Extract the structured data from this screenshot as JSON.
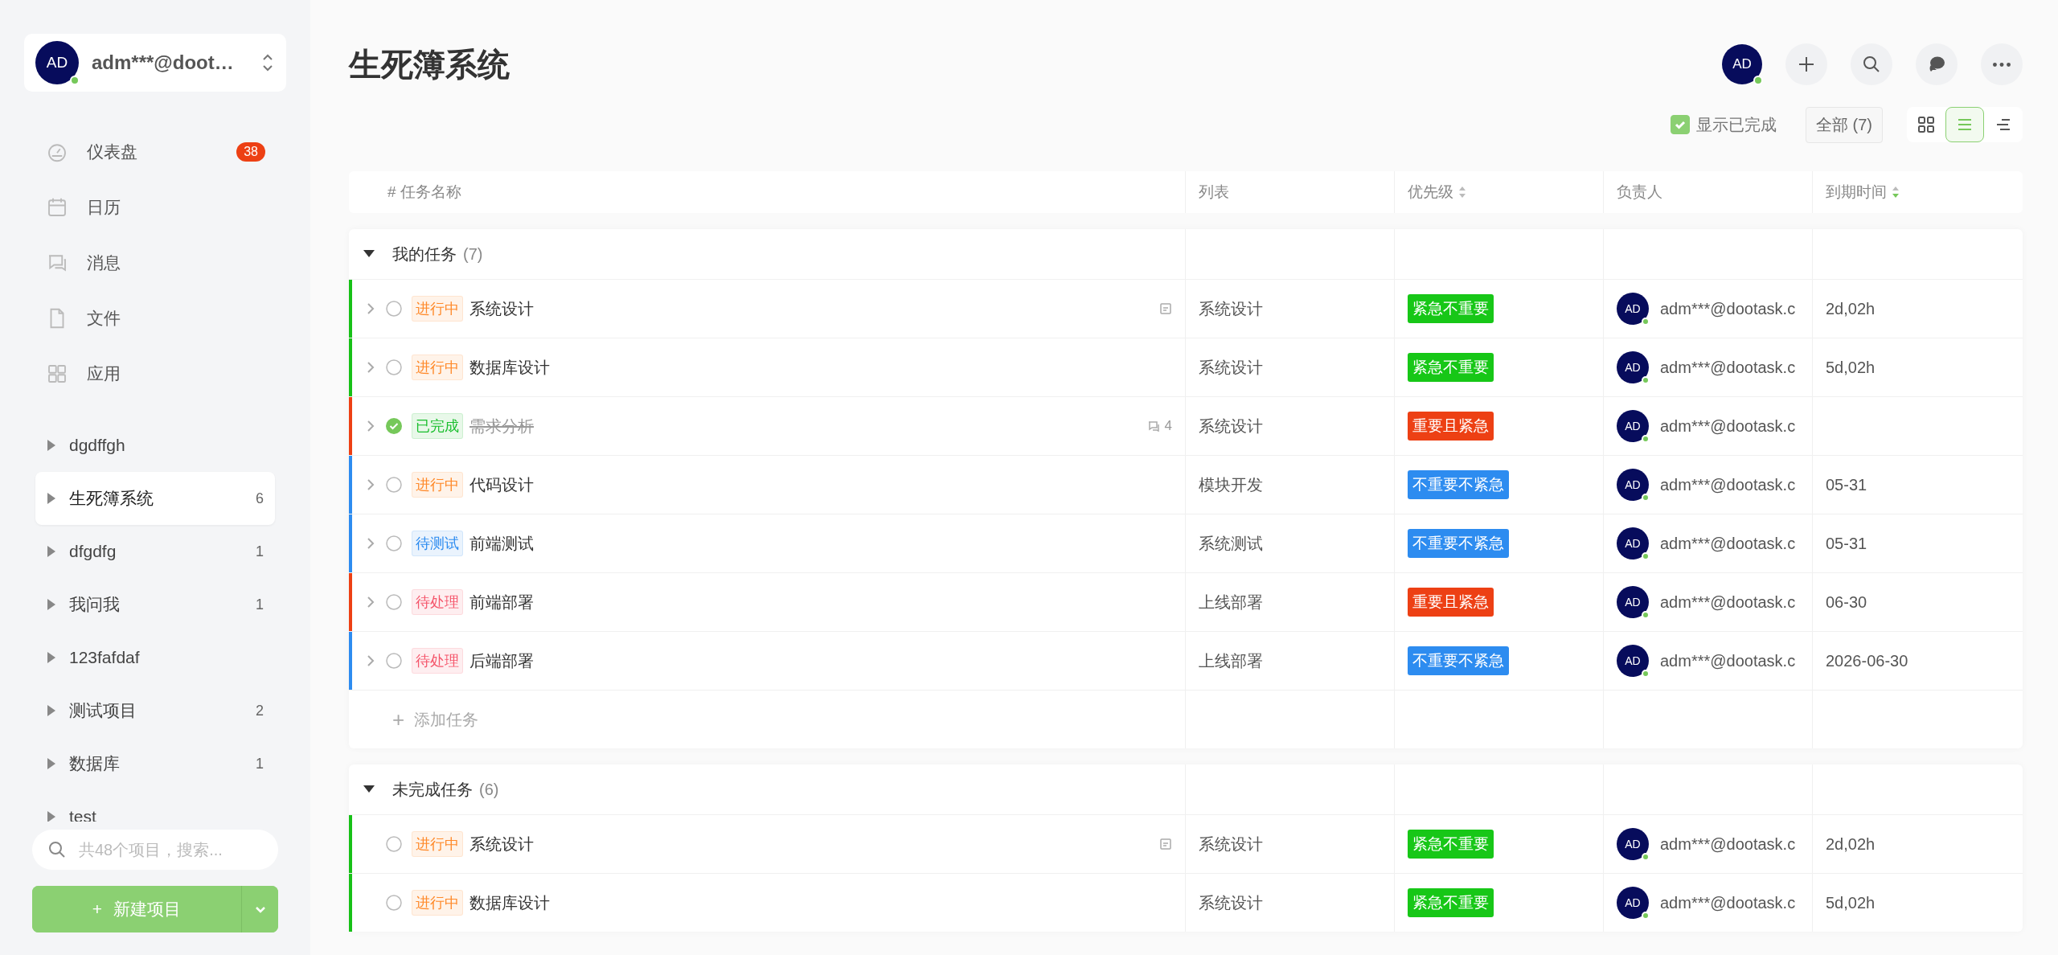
{
  "sidebar": {
    "user": {
      "avatar": "AD",
      "online": true,
      "name": "adm***@doot…"
    },
    "nav": [
      {
        "label": "仪表盘",
        "badge": "38"
      },
      {
        "label": "日历"
      },
      {
        "label": "消息"
      },
      {
        "label": "文件"
      },
      {
        "label": "应用"
      }
    ],
    "projects": [
      {
        "name": "dgdffgh",
        "selected": false
      },
      {
        "name": "生死簿系统",
        "count": "6",
        "selected": true
      },
      {
        "name": "dfgdfg",
        "count": "1",
        "selected": false
      },
      {
        "name": "我问我",
        "count": "1",
        "selected": false
      },
      {
        "name": "123fafdaf",
        "selected": false
      },
      {
        "name": "测试项目",
        "count": "2",
        "selected": false
      },
      {
        "name": "数据库",
        "count": "1",
        "selected": false
      },
      {
        "name": "test",
        "selected": false
      }
    ],
    "search": {
      "placeholder": "共48个项目，搜索..."
    },
    "new_project_button": {
      "icon": "+",
      "label": "新建项目"
    }
  },
  "header": {
    "title": "生死簿系统",
    "avatar": "AD",
    "online": true
  },
  "toolbar": {
    "show_completed": {
      "label": "显示已完成",
      "checked": true
    },
    "filter": "全部 (7)",
    "views": [
      {
        "kind": "grid",
        "selected": false
      },
      {
        "kind": "list",
        "selected": true
      },
      {
        "kind": "gantt",
        "selected": false
      }
    ]
  },
  "table": {
    "columns": [
      {
        "label": "# 任务名称"
      },
      {
        "label": "列表"
      },
      {
        "label": "优先级",
        "sorted": false
      },
      {
        "label": "负责人"
      },
      {
        "label": "到期时间",
        "sorted": true
      }
    ],
    "groups": [
      {
        "title": "我的任务",
        "count": "(7)",
        "expanded": true,
        "add_task": "添加任务",
        "rows": [
          {
            "color": "#17c117",
            "expandable": true,
            "done": false,
            "status": {
              "label": "进行中",
              "color": "#ff8a2b"
            },
            "title": "系统设计",
            "extra": {
              "kind": "note"
            },
            "list": "系统设计",
            "priority": {
              "label": "紧急不重要",
              "color": "#17c717"
            },
            "avatar": "AD",
            "assignee": "adm***@dootask.c",
            "due": "2d,02h"
          },
          {
            "color": "#17c117",
            "expandable": true,
            "done": false,
            "status": {
              "label": "进行中",
              "color": "#ff8a2b"
            },
            "title": "数据库设计",
            "list": "系统设计",
            "priority": {
              "label": "紧急不重要",
              "color": "#17c717"
            },
            "avatar": "AD",
            "assignee": "adm***@dootask.c",
            "due": "5d,02h"
          },
          {
            "color": "#ed4014",
            "expandable": true,
            "done": true,
            "status": {
              "label": "已完成",
              "color": "#19be2c"
            },
            "title": "需求分析",
            "extra": {
              "kind": "comments",
              "count": "4"
            },
            "list": "系统设计",
            "priority": {
              "label": "重要且紧急",
              "color": "#ed4014"
            },
            "avatar": "AD",
            "assignee": "adm***@dootask.c"
          },
          {
            "color": "#2d8cf0",
            "expandable": true,
            "done": false,
            "status": {
              "label": "进行中",
              "color": "#ff8a2b"
            },
            "title": "代码设计",
            "list": "模块开发",
            "priority": {
              "label": "不重要不紧急",
              "color": "#2d8cf0"
            },
            "avatar": "AD",
            "assignee": "adm***@dootask.c",
            "due": "05-31"
          },
          {
            "color": "#2d8cf0",
            "expandable": true,
            "done": false,
            "status": {
              "label": "待测试",
              "color": "#2d8cf0"
            },
            "title": "前端测试",
            "list": "系统测试",
            "priority": {
              "label": "不重要不紧急",
              "color": "#2d8cf0"
            },
            "avatar": "AD",
            "assignee": "adm***@dootask.c",
            "due": "05-31"
          },
          {
            "color": "#ed4014",
            "expandable": true,
            "done": false,
            "status": {
              "label": "待处理",
              "color": "#f5576c"
            },
            "title": "前端部署",
            "list": "上线部署",
            "priority": {
              "label": "重要且紧急",
              "color": "#ed4014"
            },
            "avatar": "AD",
            "assignee": "adm***@dootask.c",
            "due": "06-30"
          },
          {
            "color": "#2d8cf0",
            "expandable": true,
            "done": false,
            "status": {
              "label": "待处理",
              "color": "#f5576c"
            },
            "title": "后端部署",
            "list": "上线部署",
            "priority": {
              "label": "不重要不紧急",
              "color": "#2d8cf0"
            },
            "avatar": "AD",
            "assignee": "adm***@dootask.c",
            "due": "2026-06-30"
          }
        ]
      },
      {
        "title": "未完成任务",
        "count": "(6)",
        "expanded": true,
        "rows": [
          {
            "color": "#17c117",
            "expandable": false,
            "done": false,
            "status": {
              "label": "进行中",
              "color": "#ff8a2b"
            },
            "title": "系统设计",
            "extra": {
              "kind": "note"
            },
            "list": "系统设计",
            "priority": {
              "label": "紧急不重要",
              "color": "#17c717"
            },
            "avatar": "AD",
            "assignee": "adm***@dootask.c",
            "due": "2d,02h"
          },
          {
            "color": "#17c117",
            "expandable": false,
            "done": false,
            "status": {
              "label": "进行中",
              "color": "#ff8a2b"
            },
            "title": "数据库设计",
            "list": "系统设计",
            "priority": {
              "label": "紧急不重要",
              "color": "#17c717"
            },
            "avatar": "AD",
            "assignee": "adm***@dootask.c",
            "due": "5d,02h"
          }
        ]
      }
    ]
  }
}
